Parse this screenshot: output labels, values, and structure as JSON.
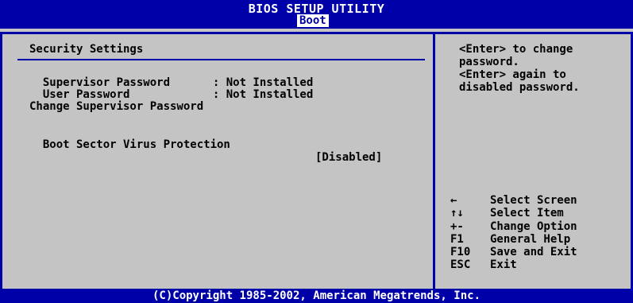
{
  "header": {
    "title": "BIOS SETUP UTILITY",
    "active_tab": "Boot"
  },
  "section": {
    "title": "Security Settings",
    "rows": [
      {
        "label": "Supervisor Password",
        "value": ": Not Installed"
      },
      {
        "label": "User Password",
        "value": ": Not Installed"
      }
    ],
    "change_supervisor": "Change Supervisor Password",
    "boot_sector": {
      "label": "Boot Sector Virus Protection",
      "value": "[Disabled]"
    }
  },
  "help": {
    "lines": [
      "<Enter> to change",
      "password.",
      "<Enter> again to",
      "disabled password."
    ]
  },
  "keys": [
    {
      "key": "←",
      "desc": "Select Screen"
    },
    {
      "key": "↑↓",
      "desc": "Select Item"
    },
    {
      "key": "+-",
      "desc": "Change Option"
    },
    {
      "key": "F1",
      "desc": "General Help"
    },
    {
      "key": "F10",
      "desc": "Save and Exit"
    },
    {
      "key": "ESC",
      "desc": "Exit"
    }
  ],
  "footer": {
    "copyright": "(C)Copyright 1985-2002, American Megatrends, Inc."
  },
  "colors": {
    "bar": "#0000a8",
    "panel": "#c4c4c4",
    "text": "#000000"
  }
}
